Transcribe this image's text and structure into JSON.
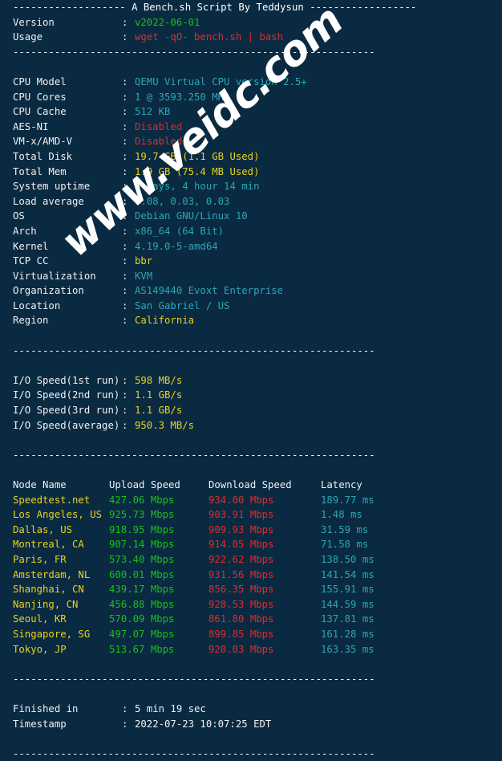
{
  "header": {
    "dashes_left": "-------------------",
    "title": " A Bench.sh Script By Teddysun ",
    "dashes_right": "------------------"
  },
  "separator": "-------------------------------------------------------------",
  "info_top": [
    {
      "label": "Version",
      "colon": ":",
      "value": "v2022-06-01",
      "color": "green"
    },
    {
      "label": "Usage",
      "colon": ":",
      "value": "wget -qO- bench.sh | bash",
      "color": "red"
    }
  ],
  "system_info": [
    {
      "label": "CPU Model",
      "colon": ":",
      "value": "QEMU Virtual CPU version 2.5+",
      "color": "cyan"
    },
    {
      "label": "CPU Cores",
      "colon": ":",
      "value": "1 @ 3593.250 MHz",
      "color": "cyan"
    },
    {
      "label": "CPU Cache",
      "colon": ":",
      "value": "512 KB",
      "color": "cyan"
    },
    {
      "label": "AES-NI",
      "colon": ":",
      "value": "Disabled",
      "color": "red"
    },
    {
      "label": "VM-x/AMD-V",
      "colon": ":",
      "value": "Disabled",
      "color": "red"
    },
    {
      "label": "Total Disk",
      "colon": ":",
      "value": "19.7 GB (1.1 GB Used)",
      "color": "yellow"
    },
    {
      "label": "Total Mem",
      "colon": ":",
      "value": "1.9 GB (75.4 MB Used)",
      "color": "yellow"
    },
    {
      "label": "System uptime",
      "colon": ":",
      "value": "0 days, 4 hour 14 min",
      "color": "cyan"
    },
    {
      "label": "Load average",
      "colon": ":",
      "value": "0.08, 0.03, 0.03",
      "color": "cyan"
    },
    {
      "label": "OS",
      "colon": ":",
      "value": "Debian GNU/Linux 10",
      "color": "cyan"
    },
    {
      "label": "Arch",
      "colon": ":",
      "value": "x86_64 (64 Bit)",
      "color": "cyan"
    },
    {
      "label": "Kernel",
      "colon": ":",
      "value": "4.19.0-5-amd64",
      "color": "cyan"
    },
    {
      "label": "TCP CC",
      "colon": ":",
      "value": "bbr",
      "color": "yellow"
    },
    {
      "label": "Virtualization",
      "colon": ":",
      "value": "KVM",
      "color": "cyan"
    },
    {
      "label": "Organization",
      "colon": ":",
      "value": "AS149440 Evoxt Enterprise",
      "color": "cyan"
    },
    {
      "label": "Location",
      "colon": ":",
      "value": "San Gabriel / US",
      "color": "cyan"
    },
    {
      "label": "Region",
      "colon": ":",
      "value": "California",
      "color": "yellow"
    }
  ],
  "io_speed": [
    {
      "label": "I/O Speed(1st run)",
      "colon": ":",
      "value": "598 MB/s",
      "color": "yellow"
    },
    {
      "label": "I/O Speed(2nd run)",
      "colon": ":",
      "value": "1.1 GB/s",
      "color": "yellow"
    },
    {
      "label": "I/O Speed(3rd run)",
      "colon": ":",
      "value": "1.1 GB/s",
      "color": "yellow"
    },
    {
      "label": "I/O Speed(average)",
      "colon": ":",
      "value": "950.3 MB/s",
      "color": "yellow"
    }
  ],
  "speedtest": {
    "columns": [
      "Node Name",
      "Upload Speed",
      "Download Speed",
      "Latency"
    ],
    "rows": [
      {
        "node": "Speedtest.net",
        "upload": "427.06 Mbps",
        "download": "934.00 Mbps",
        "latency": "189.77 ms"
      },
      {
        "node": "Los Angeles, US",
        "upload": "925.73 Mbps",
        "download": "903.91 Mbps",
        "latency": "1.48 ms"
      },
      {
        "node": "Dallas, US",
        "upload": "918.95 Mbps",
        "download": "909.93 Mbps",
        "latency": "31.59 ms"
      },
      {
        "node": "Montreal, CA",
        "upload": "907.14 Mbps",
        "download": "914.05 Mbps",
        "latency": "71.58 ms"
      },
      {
        "node": "Paris, FR",
        "upload": "573.40 Mbps",
        "download": "922.62 Mbps",
        "latency": "138.50 ms"
      },
      {
        "node": "Amsterdam, NL",
        "upload": "600.01 Mbps",
        "download": "931.56 Mbps",
        "latency": "141.54 ms"
      },
      {
        "node": "Shanghai, CN",
        "upload": "439.17 Mbps",
        "download": "856.35 Mbps",
        "latency": "155.91 ms"
      },
      {
        "node": "Nanjing, CN",
        "upload": "456.88 Mbps",
        "download": "928.53 Mbps",
        "latency": "144.59 ms"
      },
      {
        "node": "Seoul, KR",
        "upload": "570.09 Mbps",
        "download": "861.80 Mbps",
        "latency": "137.81 ms"
      },
      {
        "node": "Singapore, SG",
        "upload": "497.07 Mbps",
        "download": "899.85 Mbps",
        "latency": "161.28 ms"
      },
      {
        "node": "Tokyo, JP",
        "upload": "513.67 Mbps",
        "download": "920.03 Mbps",
        "latency": "163.35 ms"
      }
    ]
  },
  "footer": [
    {
      "label": "Finished in",
      "colon": ":",
      "value": "5 min 19 sec",
      "color": "white"
    },
    {
      "label": "Timestamp",
      "colon": ":",
      "value": "2022-07-23 10:07:25 EDT",
      "color": "white"
    }
  ],
  "watermark": {
    "text": "www.veidc.com"
  },
  "colors": {
    "background": "#0a2a42",
    "green": "#18c018",
    "red": "#e02b2b",
    "cyan": "#2aa7b5",
    "yellow": "#e8d21c",
    "white": "#f0f0f0"
  }
}
